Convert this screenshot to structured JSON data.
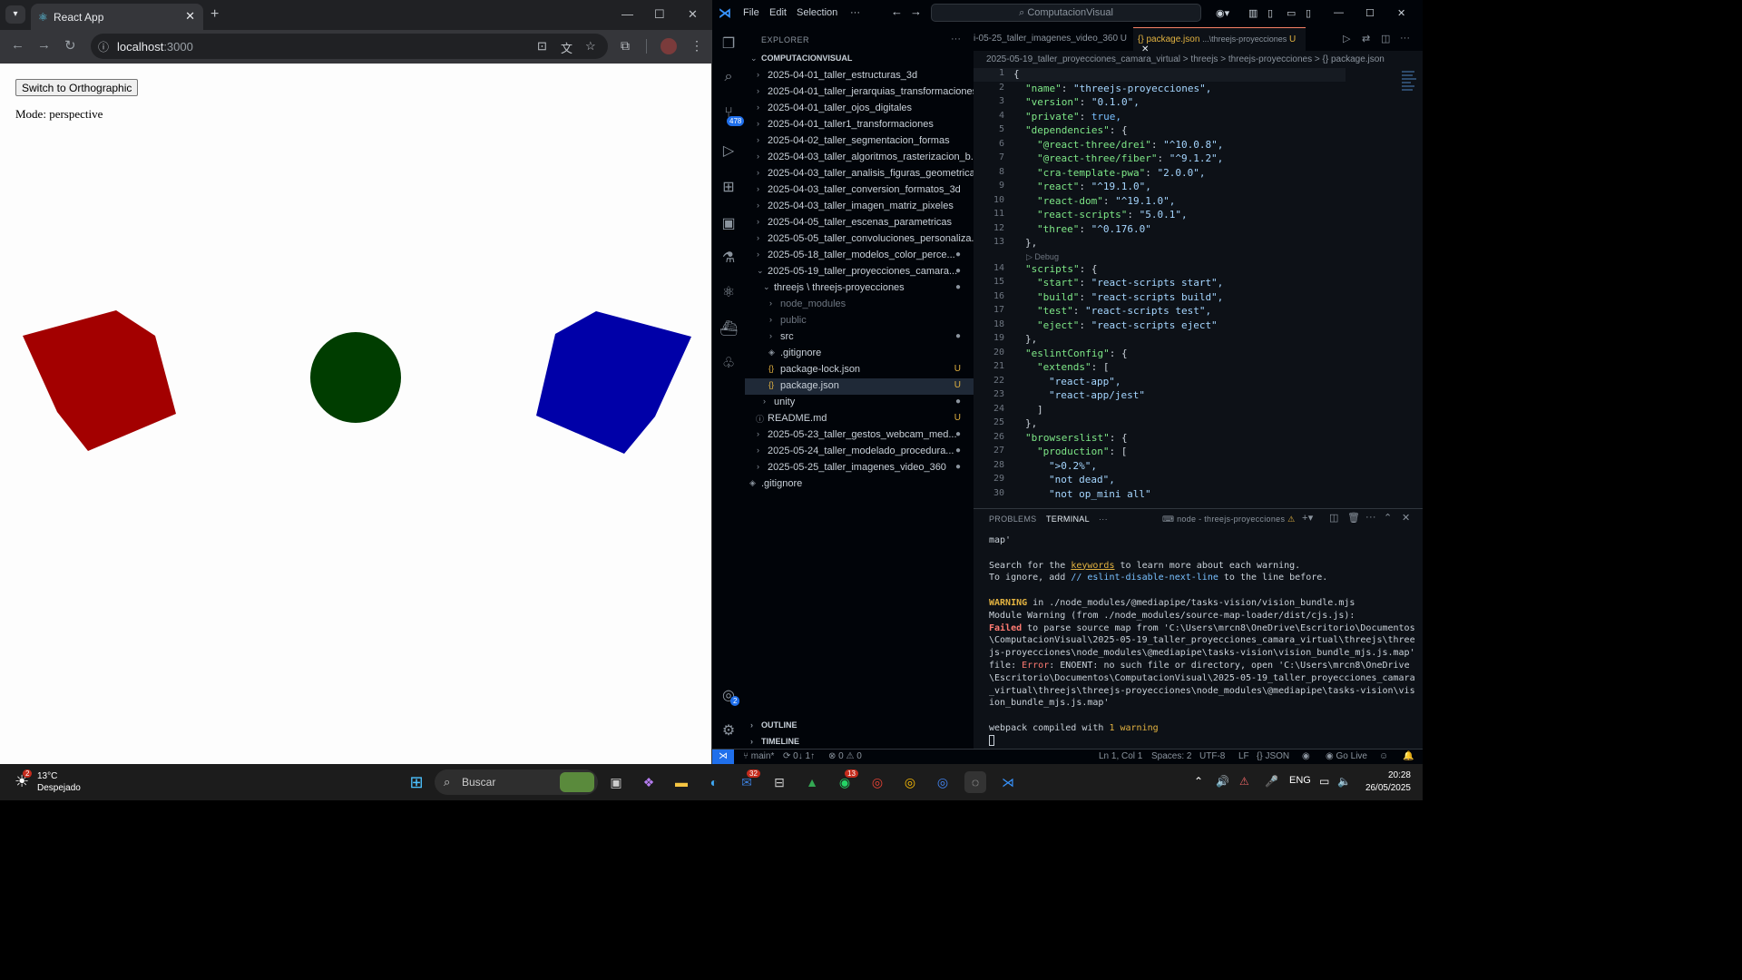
{
  "browser": {
    "tab_title": "React App",
    "url_host": "localhost",
    "url_port": ":3000",
    "page": {
      "button_label": "Switch to Orthographic",
      "mode_text": "Mode: perspective"
    },
    "scene": {
      "red_color": "#a30000",
      "green_color": "#003d00",
      "blue_color": "#0000a8"
    }
  },
  "vscode": {
    "menu": [
      "File",
      "Edit",
      "Selection",
      "···"
    ],
    "search_text": "ComputacionVisual",
    "explorer_title": "EXPLORER",
    "root_folder": "COMPUTACIONVISUAL",
    "tree": [
      {
        "label": "2025-04-01_taller_estructuras_3d",
        "status": ""
      },
      {
        "label": "2025-04-01_taller_jerarquias_transformaciones",
        "status": ""
      },
      {
        "label": "2025-04-01_taller_ojos_digitales",
        "status": ""
      },
      {
        "label": "2025-04-01_taller1_transformaciones",
        "status": ""
      },
      {
        "label": "2025-04-02_taller_segmentacion_formas",
        "status": ""
      },
      {
        "label": "2025-04-03_taller_algoritmos_rasterizacion_b...",
        "status": ""
      },
      {
        "label": "2025-04-03_taller_analisis_figuras_geometricas",
        "status": ""
      },
      {
        "label": "2025-04-03_taller_conversion_formatos_3d",
        "status": ""
      },
      {
        "label": "2025-04-03_taller_imagen_matriz_pixeles",
        "status": ""
      },
      {
        "label": "2025-04-05_taller_escenas_parametricas",
        "status": ""
      },
      {
        "label": "2025-05-05_taller_convoluciones_personaliza...",
        "status": ""
      },
      {
        "label": "2025-05-18_taller_modelos_color_perce...",
        "status": "●"
      },
      {
        "label": "2025-05-19_taller_proyecciones_camara...",
        "status": "●"
      },
      {
        "label": "threejs \\ threejs-proyecciones",
        "status": "●"
      },
      {
        "label": "node_modules",
        "status": ""
      },
      {
        "label": "public",
        "status": ""
      },
      {
        "label": "src",
        "status": "●"
      },
      {
        "label": ".gitignore",
        "status": ""
      },
      {
        "label": "package-lock.json",
        "status": "U"
      },
      {
        "label": "package.json",
        "status": "U"
      },
      {
        "label": "unity",
        "status": "●"
      },
      {
        "label": "README.md",
        "status": "U"
      },
      {
        "label": "2025-05-23_taller_gestos_webcam_med...",
        "status": "●"
      },
      {
        "label": "2025-05-24_taller_modelado_procedura...",
        "status": "●"
      },
      {
        "label": "2025-05-25_taller_imagenes_video_360",
        "status": "●"
      },
      {
        "label": ".gitignore",
        "status": ""
      }
    ],
    "outline": "OUTLINE",
    "timeline": "TIMELINE",
    "tabs": [
      {
        "label": "i-05-25_taller_imagenes_video_360  U"
      },
      {
        "label": "{} package.json",
        "sub": "...\\threejs-proyecciones",
        "status": "U"
      }
    ],
    "breadcrumb": "2025-05-19_taller_proyecciones_camara_virtual  >  threejs  >  threejs-proyecciones  >  {} package.json",
    "codelens": "▷ Debug",
    "code": [
      {
        "n": "1",
        "t": "{"
      },
      {
        "n": "2",
        "k": "\"name\"",
        "v": "\"threejs-proyecciones\","
      },
      {
        "n": "3",
        "k": "\"version\"",
        "v": "\"0.1.0\","
      },
      {
        "n": "4",
        "k": "\"private\"",
        "v": "true,"
      },
      {
        "n": "5",
        "k": "\"dependencies\"",
        "v": "{"
      },
      {
        "n": "6",
        "k": "\"@react-three/drei\"",
        "v": "\"^10.0.8\","
      },
      {
        "n": "7",
        "k": "\"@react-three/fiber\"",
        "v": "\"^9.1.2\","
      },
      {
        "n": "8",
        "k": "\"cra-template-pwa\"",
        "v": "\"2.0.0\","
      },
      {
        "n": "9",
        "k": "\"react\"",
        "v": "\"^19.1.0\","
      },
      {
        "n": "10",
        "k": "\"react-dom\"",
        "v": "\"^19.1.0\","
      },
      {
        "n": "11",
        "k": "\"react-scripts\"",
        "v": "\"5.0.1\","
      },
      {
        "n": "12",
        "k": "\"three\"",
        "v": "\"^0.176.0\""
      },
      {
        "n": "13",
        "t": "},"
      },
      {
        "n": "14",
        "k": "\"scripts\"",
        "v": "{"
      },
      {
        "n": "15",
        "k": "\"start\"",
        "v": "\"react-scripts start\","
      },
      {
        "n": "16",
        "k": "\"build\"",
        "v": "\"react-scripts build\","
      },
      {
        "n": "17",
        "k": "\"test\"",
        "v": "\"react-scripts test\","
      },
      {
        "n": "18",
        "k": "\"eject\"",
        "v": "\"react-scripts eject\""
      },
      {
        "n": "19",
        "t": "},"
      },
      {
        "n": "20",
        "k": "\"eslintConfig\"",
        "v": "{"
      },
      {
        "n": "21",
        "k": "\"extends\"",
        "v": "["
      },
      {
        "n": "22",
        "t": "\"react-app\","
      },
      {
        "n": "23",
        "t": "\"react-app/jest\""
      },
      {
        "n": "24",
        "t": "]"
      },
      {
        "n": "25",
        "t": "},"
      },
      {
        "n": "26",
        "k": "\"browserslist\"",
        "v": "{"
      },
      {
        "n": "27",
        "k": "\"production\"",
        "v": "["
      },
      {
        "n": "28",
        "t": "\">0.2%\","
      },
      {
        "n": "29",
        "t": "\"not dead\","
      },
      {
        "n": "30",
        "t": "\"not op_mini all\""
      }
    ],
    "panel": {
      "problems": "PROBLEMS",
      "terminal": "TERMINAL",
      "more": "···",
      "terminal_name": "node - threejs-proyecciones",
      "lines": {
        "l1": "map'",
        "l2a": "Search for the ",
        "l2b": "keywords",
        "l2c": " to learn more about each warning.",
        "l3a": "To ignore, add ",
        "l3b": "// eslint-disable-next-line",
        "l3c": " to the line before.",
        "l4a": "WARNING",
        "l4b": " in ./node_modules/@mediapipe/tasks-vision/vision_bundle.mjs",
        "l5": "Module Warning (from ./node_modules/source-map-loader/dist/cjs.js):",
        "l6a": "Failed",
        "l6b": " to parse source map from 'C:\\Users\\mrcn8\\OneDrive\\Escritorio\\Documentos\\ComputacionVisual\\2025-05-19_taller_proyecciones_camara_virtual\\threejs\\threejs-proyecciones\\node_modules\\@mediapipe\\tasks-vision\\vision_bundle_mjs.js.map' file: ",
        "l6c": "Error",
        "l6d": ": ENOENT: no such file or directory, open 'C:\\Users\\mrcn8\\OneDrive\\Escritorio\\Documentos\\ComputacionVisual\\2025-05-19_taller_proyecciones_camara_virtual\\threejs\\threejs-proyecciones\\node_modules\\@mediapipe\\tasks-vision\\vision_bundle_mjs.js.map'",
        "l7a": "webpack compiled with ",
        "l7b": "1 warning"
      }
    },
    "status": {
      "branch": "main*",
      "sync": "0↓ 1↑",
      "problems": "⊗ 0 ⚠ 0",
      "position": "Ln 1, Col 1",
      "spaces": "Spaces: 2",
      "encoding": "UTF-8",
      "eol": "LF",
      "language": "{} JSON",
      "golive": "Go Live"
    },
    "badges": {
      "scm": "478",
      "accounts": "2"
    }
  },
  "taskbar": {
    "temp": "13°C",
    "weather": "Despejado",
    "search": "Buscar",
    "lang": "ENG",
    "time": "20:28",
    "date": "26/05/2025",
    "badges": {
      "weather": "2",
      "mail": "32",
      "whatsapp": "13"
    }
  }
}
